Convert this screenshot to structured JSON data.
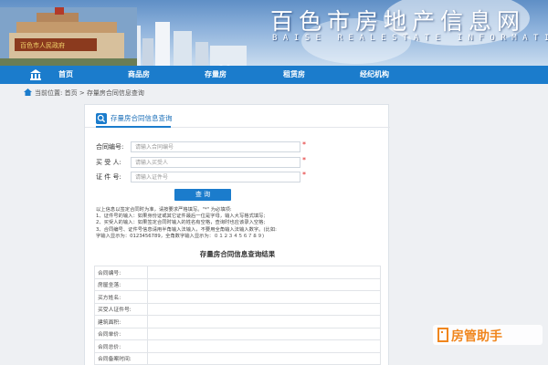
{
  "banner": {
    "title": "百色市房地产信息网",
    "subtitle": "BAISE REALESTATE INFORMATION NETWORK"
  },
  "nav": {
    "items": [
      {
        "label": "首页"
      },
      {
        "label": "商品房"
      },
      {
        "label": "存量房"
      },
      {
        "label": "租赁房"
      },
      {
        "label": "经纪机构"
      }
    ]
  },
  "breadcrumb": {
    "prefix": "当前位置:",
    "home": "首页",
    "separator": ">",
    "current": "存量房合同信息查询"
  },
  "tab": {
    "label": "存量房合同信息查询"
  },
  "form": {
    "fields": [
      {
        "label": "合同编号:",
        "placeholder": "请输入合同编号",
        "required": "*"
      },
      {
        "label": "买 受 人:",
        "placeholder": "请输入买受人",
        "required": "*"
      },
      {
        "label": "证 件 号:",
        "placeholder": "请输入证件号",
        "required": "*"
      }
    ],
    "submit_label": "查 询"
  },
  "notes": [
    "以上信息以签定合同时为准，请按要求严格填写。\"*\" 为必填项:",
    "1、证件号的输入：如果身份证或其它证件最后一位是字母，输入大写格式填写;",
    "2、买受人的输入：如果签定合同时输入的姓名有空格，查询时也应该录入空格;",
    "3、合同编号、证件号信息请用半角输入法输入，不要用全角输入法输入数字。(比如:",
    "字输入显示为：0123456789，全角数字输入显示为：０１２３４５６７８９)"
  ],
  "result": {
    "title": "存量房合同信息查询结果",
    "rows": [
      {
        "key": "合同编号:",
        "value": ""
      },
      {
        "key": "房屋坐落:",
        "value": ""
      },
      {
        "key": "买方姓名:",
        "value": ""
      },
      {
        "key": "买受人证件号:",
        "value": ""
      },
      {
        "key": "建筑面积:",
        "value": ""
      },
      {
        "key": "合同单价:",
        "value": ""
      },
      {
        "key": "合同总价:",
        "value": ""
      },
      {
        "key": "合同备案时间:",
        "value": ""
      }
    ]
  },
  "watermark": {
    "text": "房管助手"
  },
  "colors": {
    "nav_bg": "#1b7ccc",
    "required": "#e02020",
    "watermark": "#f0861e"
  }
}
